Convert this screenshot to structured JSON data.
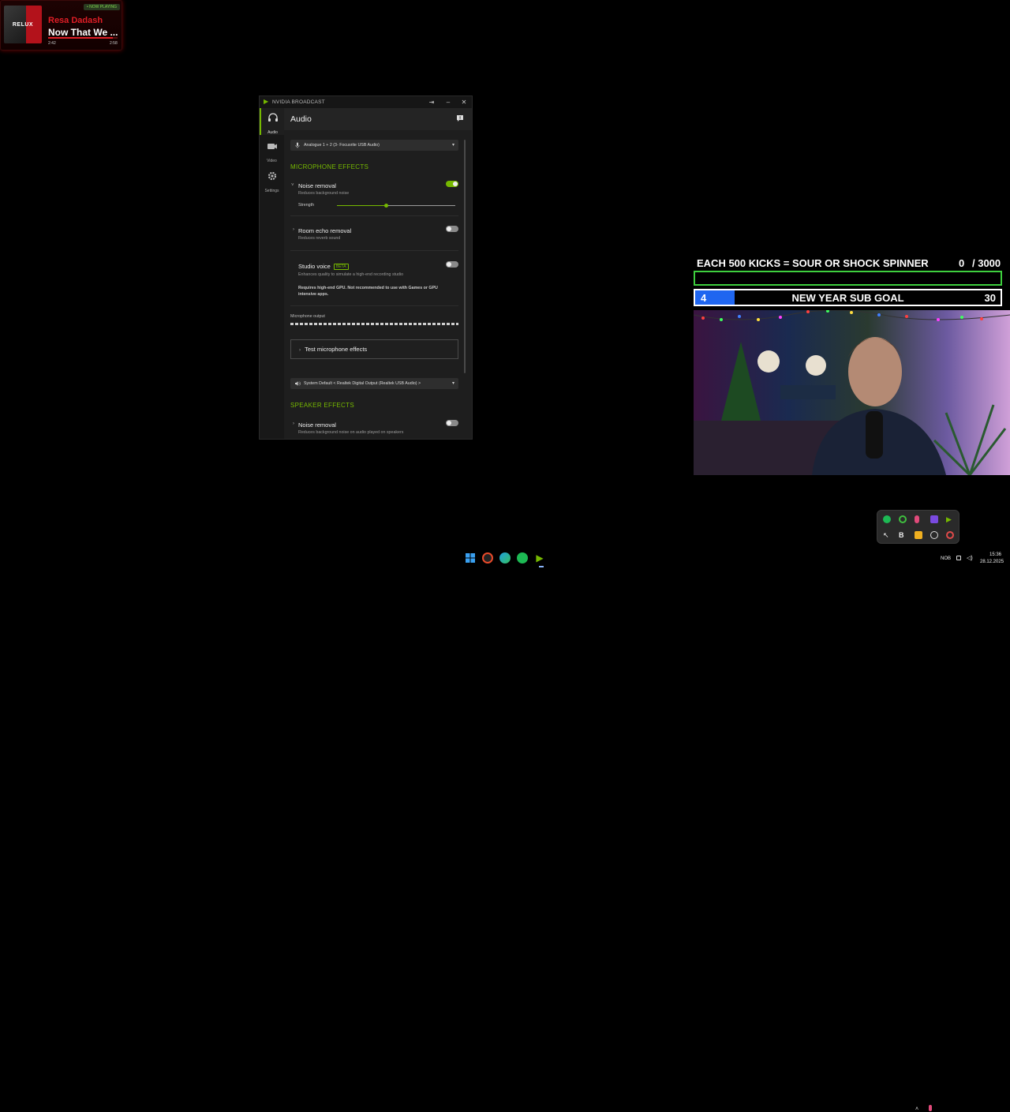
{
  "now_playing": {
    "badge": "• NOW PLAYING",
    "cover_mark": "RELUX",
    "artist": "Resa Dadash",
    "title": "Now That We ...",
    "elapsed": "2:42",
    "total": "2:58",
    "progress": 0.93
  },
  "broadcast": {
    "window_title": "NVIDIA BROADCAST",
    "nav": [
      {
        "label": "Audio",
        "icon": "headphones-icon"
      },
      {
        "label": "Video",
        "icon": "camera-icon"
      },
      {
        "label": "Settings",
        "icon": "gear-icon"
      }
    ],
    "heading": "Audio",
    "mic_device": "Analogue 1 + 2 (3- Focusrite USB Audio)",
    "mic_section": "MICROPHONE EFFECTS",
    "noise_removal": {
      "title": "Noise removal",
      "desc": "Reduces background noise",
      "enabled": true
    },
    "strength_label": "Strength",
    "strength_value": 0.41,
    "room_echo": {
      "title": "Room echo removal",
      "desc": "Reduces reverb sound",
      "enabled": false
    },
    "studio_voice": {
      "title": "Studio voice",
      "badge": "BETA",
      "desc": "Enhances quality to simulate a high-end recording studio",
      "note": "Requires high-end GPU. Not recommended to use with Games or GPU intensive apps.",
      "enabled": false
    },
    "mic_output_label": "Microphone output",
    "test_button": "Test microphone effects",
    "speaker_device": "System Default < Realtek Digital Output (Realtek USB Audio) >",
    "speaker_section": "SPEAKER EFFECTS",
    "speaker_noise": {
      "title": "Noise removal",
      "desc": "Reduces background noise on audio played on speakers",
      "enabled": false
    }
  },
  "overlay": {
    "kicks_label": "EACH 500 KICKS = SOUR OR SHOCK SPINNER",
    "kicks_current": "0",
    "kicks_target": "/ 3000",
    "kicks_progress": 0,
    "sub_current": "4",
    "sub_label": "NEW YEAR SUB GOAL",
    "sub_target": "30",
    "sub_progress": 0.13
  },
  "taskbar": {
    "language": "NOB",
    "time": "15:36",
    "date": "28.12.2025"
  },
  "colors": {
    "nvidia_green": "#76b900",
    "goal_green": "#3ecf3e",
    "sub_blue": "#1f66f0",
    "np_red": "#e01e26"
  }
}
